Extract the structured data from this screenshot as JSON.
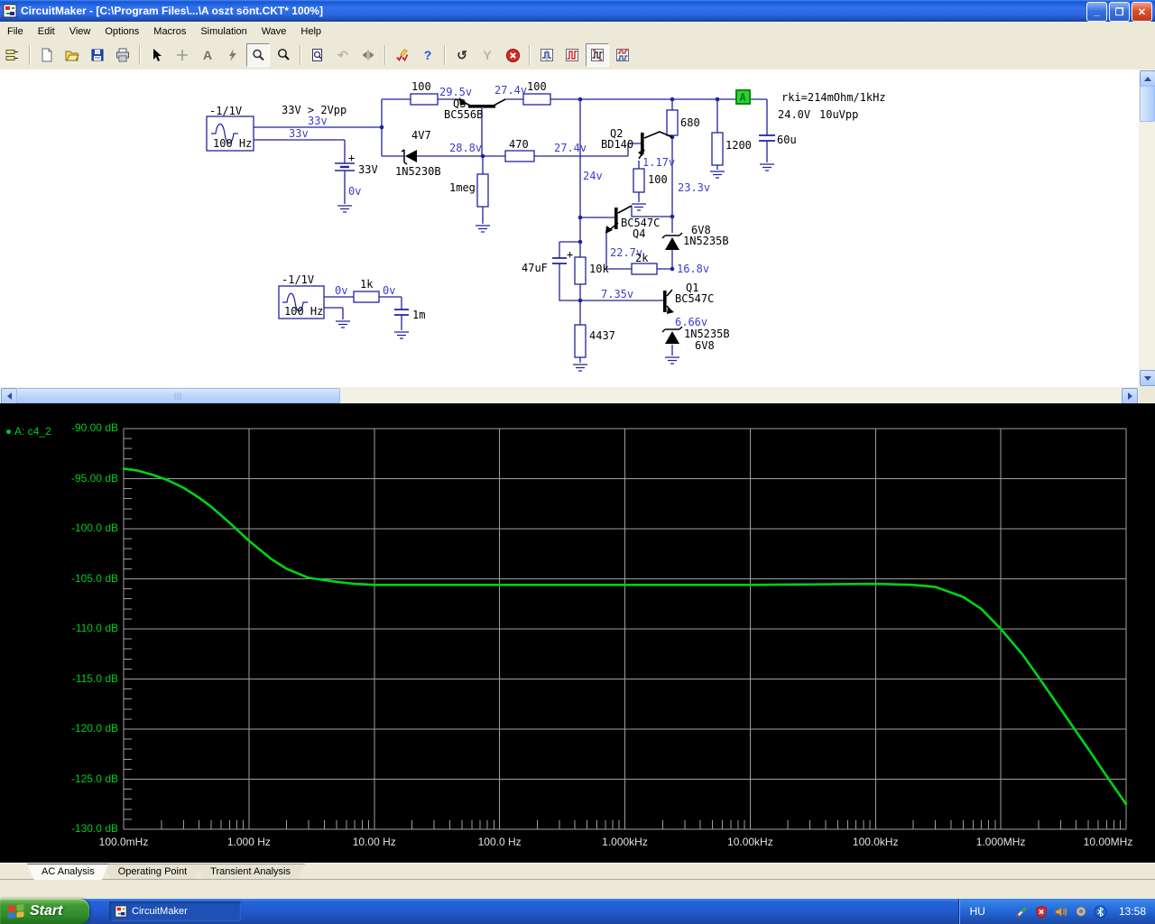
{
  "window": {
    "title": "CircuitMaker - [C:\\Program Files\\...\\A oszt sönt.CKT* 100%]",
    "minimize": "_",
    "restore": "❐",
    "close": "✕"
  },
  "menu": {
    "items": [
      "File",
      "Edit",
      "View",
      "Options",
      "Macros",
      "Simulation",
      "Wave",
      "Help"
    ]
  },
  "icons": {
    "text_tool": "A",
    "rotate": "↶",
    "help": "?",
    "undo": "↺",
    "step": "Y"
  },
  "schematic": {
    "src1_range": "-1/1V",
    "src1_freq": "100 Hz",
    "note_drive": "33V > 2Vpp",
    "v33_a": "33v",
    "v33_b": "33v",
    "battery_plus": "+",
    "battery_value": "33V",
    "v0_battery": "0v",
    "r1_value": "100",
    "v29_5": "29.5v",
    "q3_ref": "Q3",
    "q3_part": "BC556B",
    "v27_4_a": "27.4v",
    "r2_value": "100",
    "zener1_v": "4V7",
    "zener1_part": "1N5230B",
    "v28_8": "28.8v",
    "r_1meg": "1meg",
    "r470": "470",
    "v27_4_b": "27.4v",
    "v24": "24v",
    "q2_ref": "Q2",
    "q2_part": "BD140",
    "v1_17": "1.17v",
    "r_q2": "100",
    "v23_3": "23.3v",
    "r680": "680",
    "r1200": "1200",
    "cap60u": "60u",
    "probe_a": "A",
    "note_rki": "rki=214mOhm/1kHz",
    "out_v": "24.0V",
    "out_vpp": "10uVpp",
    "q4_part": "BC547C",
    "q4_ref": "Q4",
    "v22_7": "22.7v",
    "r2k": "2k",
    "v16_8": "16.8v",
    "zener2_v": "6V8",
    "zener2_part": "1N5235B",
    "cap47": "47uF",
    "cap47_plus": "+",
    "r10k": "10k",
    "v7_35": "7.35v",
    "r4437": "4437",
    "q1_ref": "Q1",
    "q1_part": "BC547C",
    "v6_66": "6.66v",
    "zener3_part": "1N5235B",
    "zener3_v": "6V8",
    "src2_range": "-1/1V",
    "src2_freq": "100 Hz",
    "v0_a": "0v",
    "r1k": "1k",
    "v0_b": "0v",
    "cap1m": "1m"
  },
  "chart_data": {
    "type": "line",
    "title": "AC Analysis",
    "legend": [
      {
        "name": "A: c4_2",
        "color": "#00cc22"
      }
    ],
    "x_axis": {
      "scale": "log",
      "min_hz": 0.1,
      "max_hz": 10000000,
      "tick_labels": [
        "100.0mHz",
        "1.000 Hz",
        "10.00 Hz",
        "100.0 Hz",
        "1.000kHz",
        "10.00kHz",
        "100.0kHz",
        "1.000MHz",
        "10.00MHz"
      ]
    },
    "y_axis": {
      "unit": "dB",
      "max": -90,
      "min": -130,
      "tick_labels": [
        "-90.00 dB",
        "-95.00 dB",
        "-100.0 dB",
        "-105.0 dB",
        "-110.0 dB",
        "-115.0 dB",
        "-120.0 dB",
        "-125.0 dB",
        "-130.0 dB"
      ]
    },
    "grid": true,
    "series": [
      {
        "name": "A: c4_2",
        "color": "#00d318",
        "points_hz_db": [
          [
            0.1,
            -94.0
          ],
          [
            0.13,
            -94.2
          ],
          [
            0.17,
            -94.6
          ],
          [
            0.22,
            -95.1
          ],
          [
            0.3,
            -95.9
          ],
          [
            0.4,
            -96.9
          ],
          [
            0.5,
            -97.8
          ],
          [
            0.7,
            -99.4
          ],
          [
            1,
            -101.2
          ],
          [
            1.5,
            -103.0
          ],
          [
            2,
            -104.0
          ],
          [
            3,
            -104.9
          ],
          [
            5,
            -105.3
          ],
          [
            7,
            -105.5
          ],
          [
            10,
            -105.6
          ],
          [
            100,
            -105.6
          ],
          [
            1000,
            -105.6
          ],
          [
            10000,
            -105.6
          ],
          [
            100000,
            -105.5
          ],
          [
            200000,
            -105.6
          ],
          [
            300000,
            -105.8
          ],
          [
            500000,
            -106.8
          ],
          [
            700000,
            -108.0
          ],
          [
            1000000,
            -110.0
          ],
          [
            1500000,
            -112.6
          ],
          [
            2000000,
            -114.8
          ],
          [
            3000000,
            -118.0
          ],
          [
            5000000,
            -122.0
          ],
          [
            7000000,
            -124.7
          ],
          [
            10000000,
            -127.5
          ]
        ]
      }
    ]
  },
  "tabs": [
    {
      "label": "AC Analysis",
      "active": true
    },
    {
      "label": "Operating Point",
      "active": false
    },
    {
      "label": "Transient Analysis",
      "active": false
    }
  ],
  "taskbar": {
    "start_label": "Start",
    "task_label": "CircuitMaker",
    "language": "HU",
    "time": "13:58"
  }
}
